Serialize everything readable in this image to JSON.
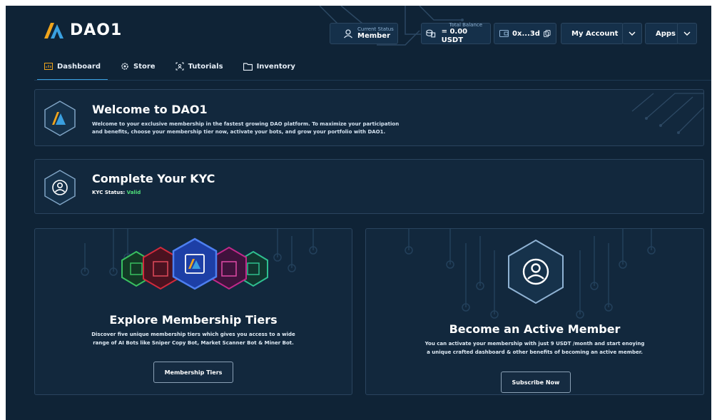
{
  "app": {
    "name": "DAO1"
  },
  "header": {
    "status_label": "Current Status",
    "status_value": "Member",
    "balance_label": "Total Balance",
    "balance_value": "= 0.00 USDT",
    "wallet": "0x...3d",
    "account_label": "My Account",
    "apps_label": "Apps"
  },
  "nav": {
    "items": [
      {
        "label": "Dashboard",
        "icon": "dashboard-icon",
        "active": true
      },
      {
        "label": "Store",
        "icon": "gear-icon"
      },
      {
        "label": "Tutorials",
        "icon": "tutorial-icon"
      },
      {
        "label": "Inventory",
        "icon": "folder-icon"
      }
    ]
  },
  "welcome": {
    "title": "Welcome to DAO1",
    "line1": "Welcome to your exclusive membership in the fastest growing DAO platform. To maximize your participation",
    "line2": "and benefits, choose your membership tier now, activate your bots, and grow your portfolio with DAO1."
  },
  "kyc": {
    "title": "Complete Your KYC",
    "status_label": "KYC Status: ",
    "status_value": "Valid"
  },
  "tiers_card": {
    "title": "Explore Membership Tiers",
    "line1": "Discover five unique membership tiers which gives you access to a wide",
    "line2": "range of AI Bots like Sniper Copy Bot, Market Scanner Bot & Miner Bot.",
    "button": "Membership Tiers"
  },
  "member_card": {
    "title": "Become an Active Member",
    "line1": "You can activate your membership with just 9 USDT /month and start enoying",
    "line2": "a unique crafted dashboard & other benefits of becoming an active member.",
    "button": "Subscribe Now"
  },
  "colors": {
    "background": "#0f2336",
    "card": "#12283d",
    "accent": "#3aa0e0",
    "valid": "#4fe07a"
  }
}
